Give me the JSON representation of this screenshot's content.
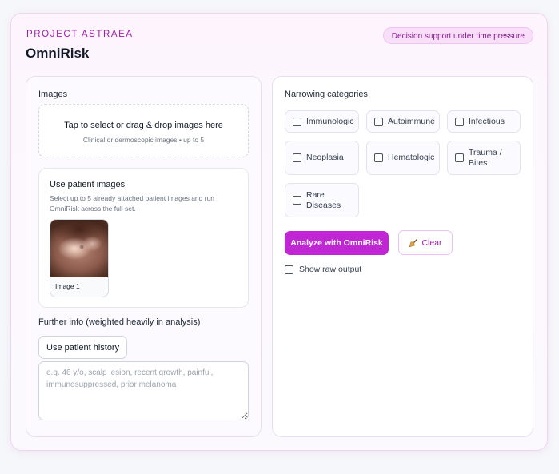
{
  "header": {
    "project": "PROJECT ASTRAEA",
    "title": "OmniRisk",
    "badge": "Decision support under time pressure"
  },
  "images": {
    "label": "Images",
    "dropzone_title": "Tap to select or drag & drop images here",
    "dropzone_sub": "Clinical or dermoscopic images • up to 5"
  },
  "patient_images": {
    "title": "Use patient images",
    "description": "Select up to 5 already attached patient images and run OmniRisk across the full set.",
    "items": [
      {
        "caption": "Image 1"
      }
    ]
  },
  "further_info": {
    "label": "Further info (weighted heavily in analysis)",
    "history_button": "Use patient history",
    "placeholder": "e.g. 46 y/o, scalp lesion, recent growth, painful, immunosuppressed, prior melanoma"
  },
  "categories": {
    "label": "Narrowing categories",
    "items": [
      {
        "label": "Immunologic",
        "checked": false
      },
      {
        "label": "Autoimmune",
        "checked": false
      },
      {
        "label": "Infectious",
        "checked": false
      },
      {
        "label": "Neoplasia",
        "checked": false
      },
      {
        "label": "Hematologic",
        "checked": false
      },
      {
        "label": "Trauma / Bites",
        "checked": false
      },
      {
        "label": "Rare Diseases",
        "checked": false
      }
    ]
  },
  "actions": {
    "analyze": "Analyze with OmniRisk",
    "clear": "Clear",
    "raw_output": "Show raw output"
  },
  "colors": {
    "accent": "#c026d3",
    "accent_text": "#a21caf",
    "badge_bg": "#f8def9"
  }
}
